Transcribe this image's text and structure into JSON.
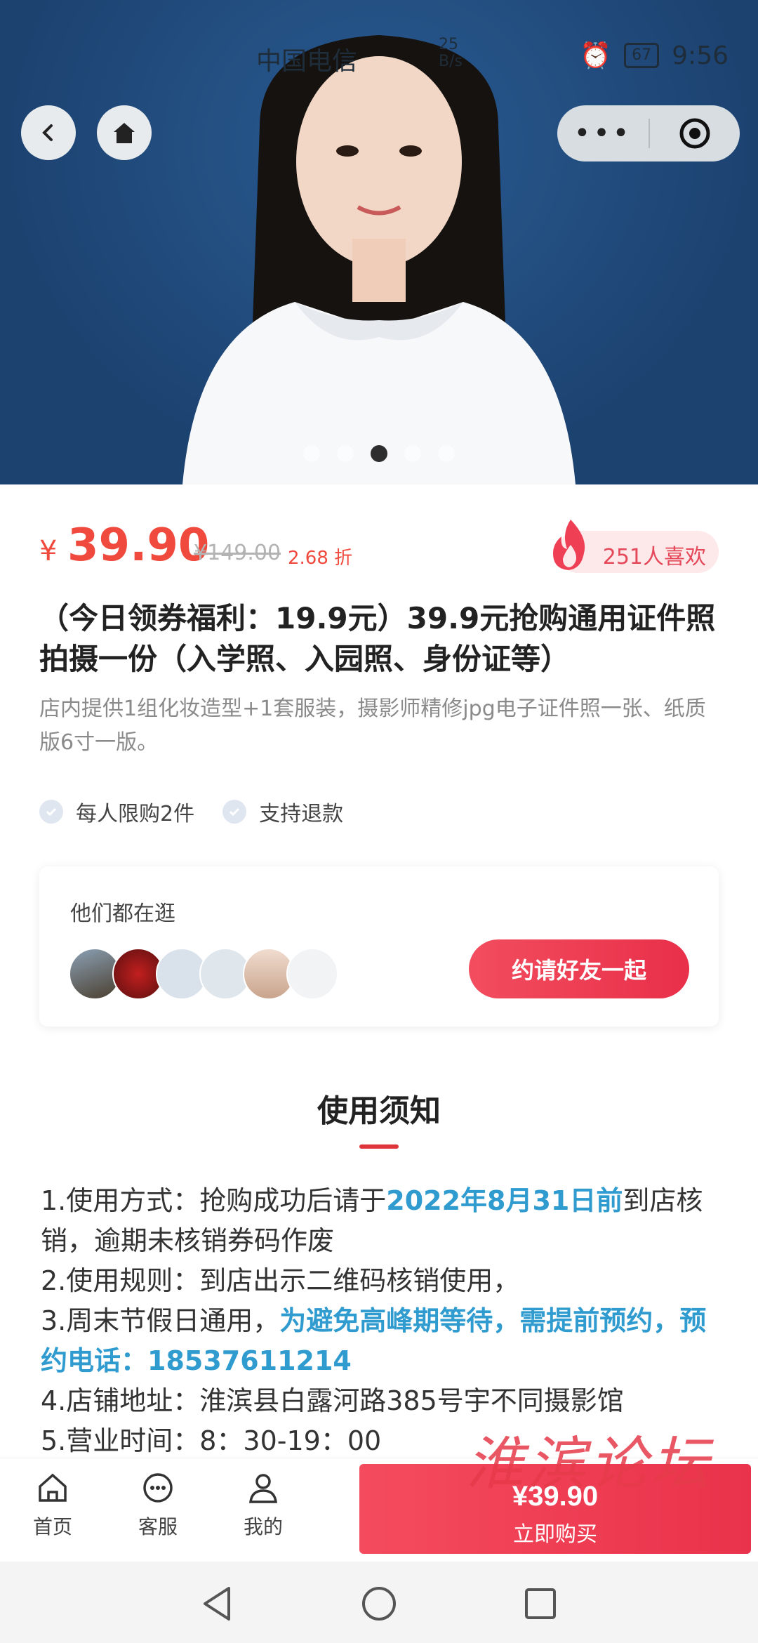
{
  "status_bar": {
    "carrier": "中国电信",
    "net_speed": "25\nB/s",
    "battery": "67",
    "time": "9:56"
  },
  "nav": {
    "back_icon": "chevron-left-icon",
    "home_icon": "home-icon",
    "more_label": "•••",
    "close_icon": "target-icon"
  },
  "carousel": {
    "pages": 5,
    "active_index": 2
  },
  "price": {
    "currency": "¥",
    "value": "39.90",
    "original": "¥149.00",
    "discount": "2.68 折",
    "likes": "251人喜欢"
  },
  "product": {
    "title": "（今日领券福利：19.9元）39.9元抢购通用证件照拍摄一份（入学照、入园照、身份证等）",
    "description": "店内提供1组化妆造型+1套服装，摄影师精修jpg电子证件照一张、纸质版6寸一版。",
    "tags": [
      "每人限购2件",
      "支持退款"
    ]
  },
  "browsing": {
    "label": "他们都在逛",
    "invite_label": "约请好友一起"
  },
  "notice": {
    "title": "使用须知",
    "line1_a": "1.使用方式：抢购成功后请于",
    "line1_hl": "2022年8月31日前",
    "line1_b": "到店核销，逾期未核销券码作废",
    "line2": "2.使用规则：到店出示二维码核销使用，",
    "line3_a": "3.周末节假日通用，",
    "line3_hl": "为避免高峰期等待，需提前预约，预约电话：18537611214",
    "line4": "4.店铺地址：淮滨县白露河路385号宇不同摄影馆",
    "line5": "5.营业时间：8：30-19：00"
  },
  "bottom": {
    "tabs": [
      {
        "label": "首页",
        "icon": "home-icon"
      },
      {
        "label": "客服",
        "icon": "chat-icon"
      },
      {
        "label": "我的",
        "icon": "user-icon"
      }
    ],
    "buy_price": "¥39.90",
    "buy_label": "立即购买"
  },
  "watermark": "淮滨论坛",
  "colors": {
    "accent_red": "#e9324b",
    "price_red": "#f04a3e",
    "highlight_blue": "#2f9bcf",
    "hero_bg": "#1f4a7a"
  }
}
